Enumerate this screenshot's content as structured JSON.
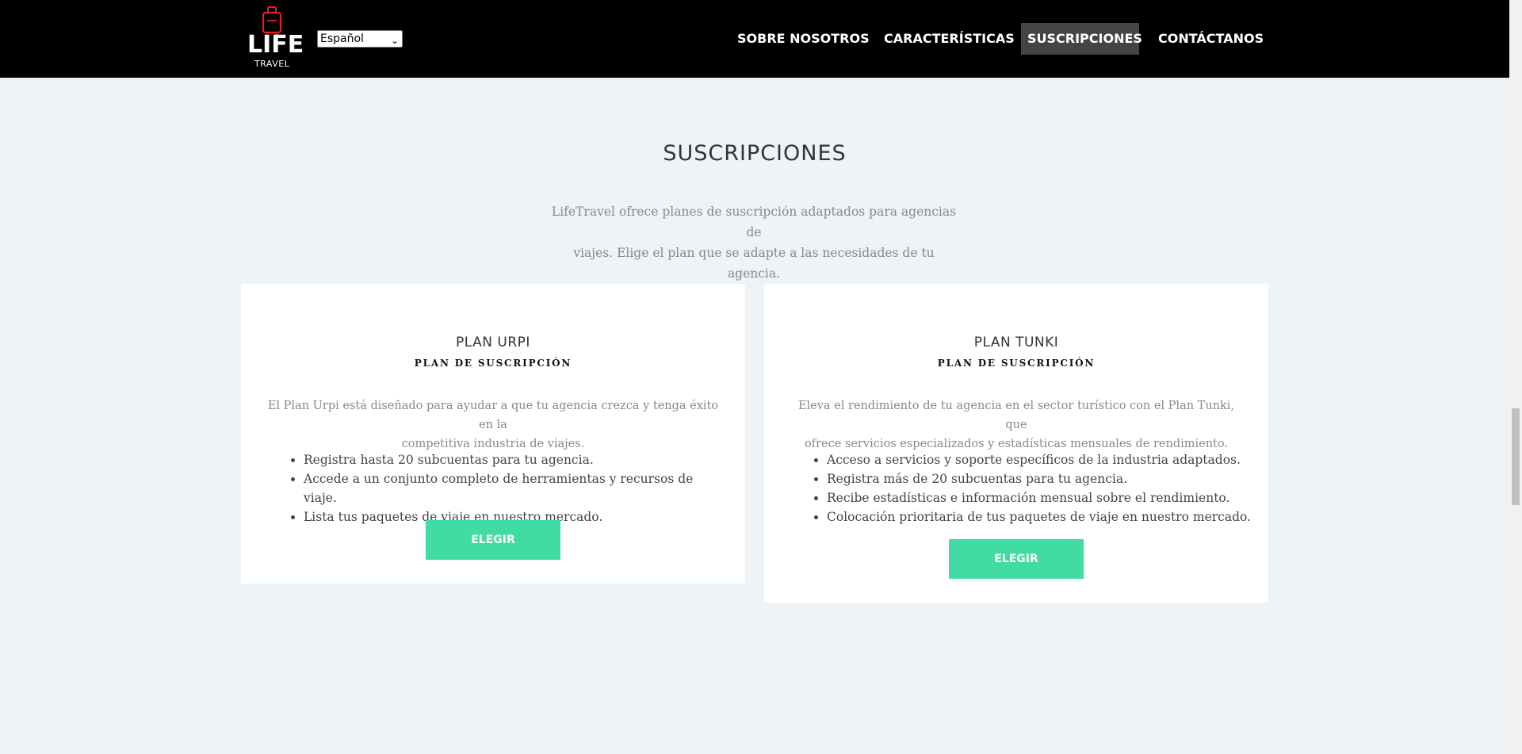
{
  "nav": {
    "logo": {
      "word": "LIFE",
      "sub": "TRAVEL"
    },
    "language_selected": "Español",
    "items": [
      {
        "label": "SOBRE NOSOTROS",
        "active": false
      },
      {
        "label": "CARACTERÍSTICAS",
        "active": false
      },
      {
        "label": "SUSCRIPCIONES",
        "active": true
      },
      {
        "label": "CONTÁCTANOS",
        "active": false
      }
    ]
  },
  "section": {
    "title": "SUSCRIPCIONES",
    "description_line1": "LifeTravel ofrece planes de suscripción adaptados para agencias de",
    "description_line2": "viajes. Elige el plan que se adapte a las necesidades de tu agencia."
  },
  "plans": [
    {
      "title": "PLAN URPI",
      "subtitle": "PLAN DE SUSCRIPCIÓN",
      "description_line1": "El Plan Urpi está diseñado para ayudar a que tu agencia crezca y tenga éxito en la",
      "description_line2": "competitiva industria de viajes.",
      "features": [
        "Registra hasta 20 subcuentas para tu agencia.",
        "Accede a un conjunto completo de herramientas y recursos de viaje.",
        "Lista tus paquetes de viaje en nuestro mercado."
      ],
      "button": "ELEGIR"
    },
    {
      "title": "PLAN TUNKI",
      "subtitle": "PLAN DE SUSCRIPCIÓN",
      "description_line1": "Eleva el rendimiento de tu agencia en el sector turístico con el Plan Tunki, que",
      "description_line2": "ofrece servicios especializados y estadísticas mensuales de rendimiento.",
      "features": [
        "Acceso a servicios y soporte específicos de la industria adaptados.",
        "Registra más de 20 subcuentas para tu agencia.",
        "Recibe estadísticas e información mensual sobre el rendimiento.",
        "Colocación prioritaria de tus paquetes de viaje en nuestro mercado."
      ],
      "button": "ELEGIR"
    }
  ],
  "colors": {
    "accent": "#41dca3",
    "nav_bg": "#000000",
    "active_nav_bg": "#444444",
    "logo_red": "#e02020"
  }
}
